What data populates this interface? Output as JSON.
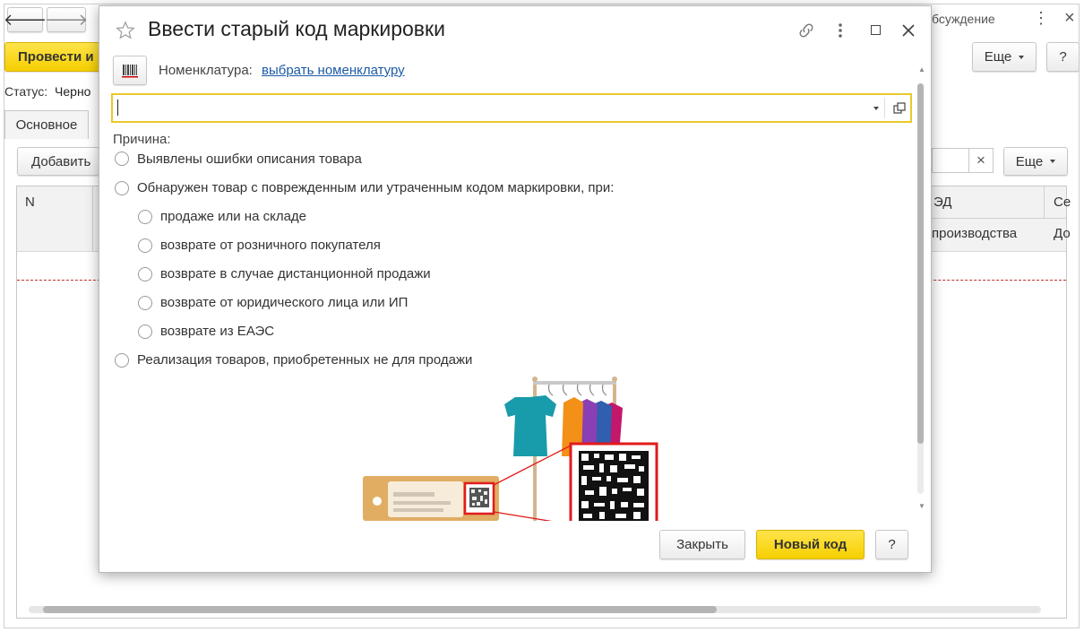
{
  "background": {
    "nav_back": "🡐",
    "nav_forward": "🡒",
    "post_button": "Провести и",
    "status_label": "Статус:",
    "status_value": "Черно",
    "tab_main": "Основное",
    "add_button": "Добавить",
    "discussion": "бсуждение",
    "more_button_top": "Еще",
    "help_top": "?",
    "more_button_table": "Еще",
    "clear_icon": "×",
    "more_dots": "⋮",
    "close_icon": "×",
    "columns": {
      "n": "N",
      "ed": "ЭД",
      "se": "Се",
      "production": "производства",
      "do": "До"
    }
  },
  "dialog": {
    "title": "Ввести старый код маркировки",
    "nomenclature_label": "Номенклатура:",
    "nomenclature_link": "выбрать номенклатуру",
    "code_input_value": "",
    "reason_label": "Причина:",
    "options": [
      {
        "label": "Выявлены ошибки описания товара",
        "level": 0
      },
      {
        "label": "Обнаружен товар с поврежденным или утраченным кодом маркировки, при:",
        "level": 0
      },
      {
        "label": "продаже или на складе",
        "level": 1
      },
      {
        "label": "возврате от розничного покупателя",
        "level": 1
      },
      {
        "label": "возврате в случае дистанционной продажи",
        "level": 1
      },
      {
        "label": "возврате от юридического лица или ИП",
        "level": 1
      },
      {
        "label": "возврате из ЕАЭС",
        "level": 1
      },
      {
        "label": "Реализация товаров, приобретенных не для продажи",
        "level": 0
      }
    ],
    "close_button": "Закрыть",
    "new_code_button": "Новый код",
    "help_button": "?"
  },
  "colors": {
    "accent_yellow": "#f5cf00",
    "link_blue": "#1c5aa6",
    "focus_border": "#e8c92a",
    "qr_red": "#e11b1b",
    "tag_tan": "#e0ad63"
  }
}
